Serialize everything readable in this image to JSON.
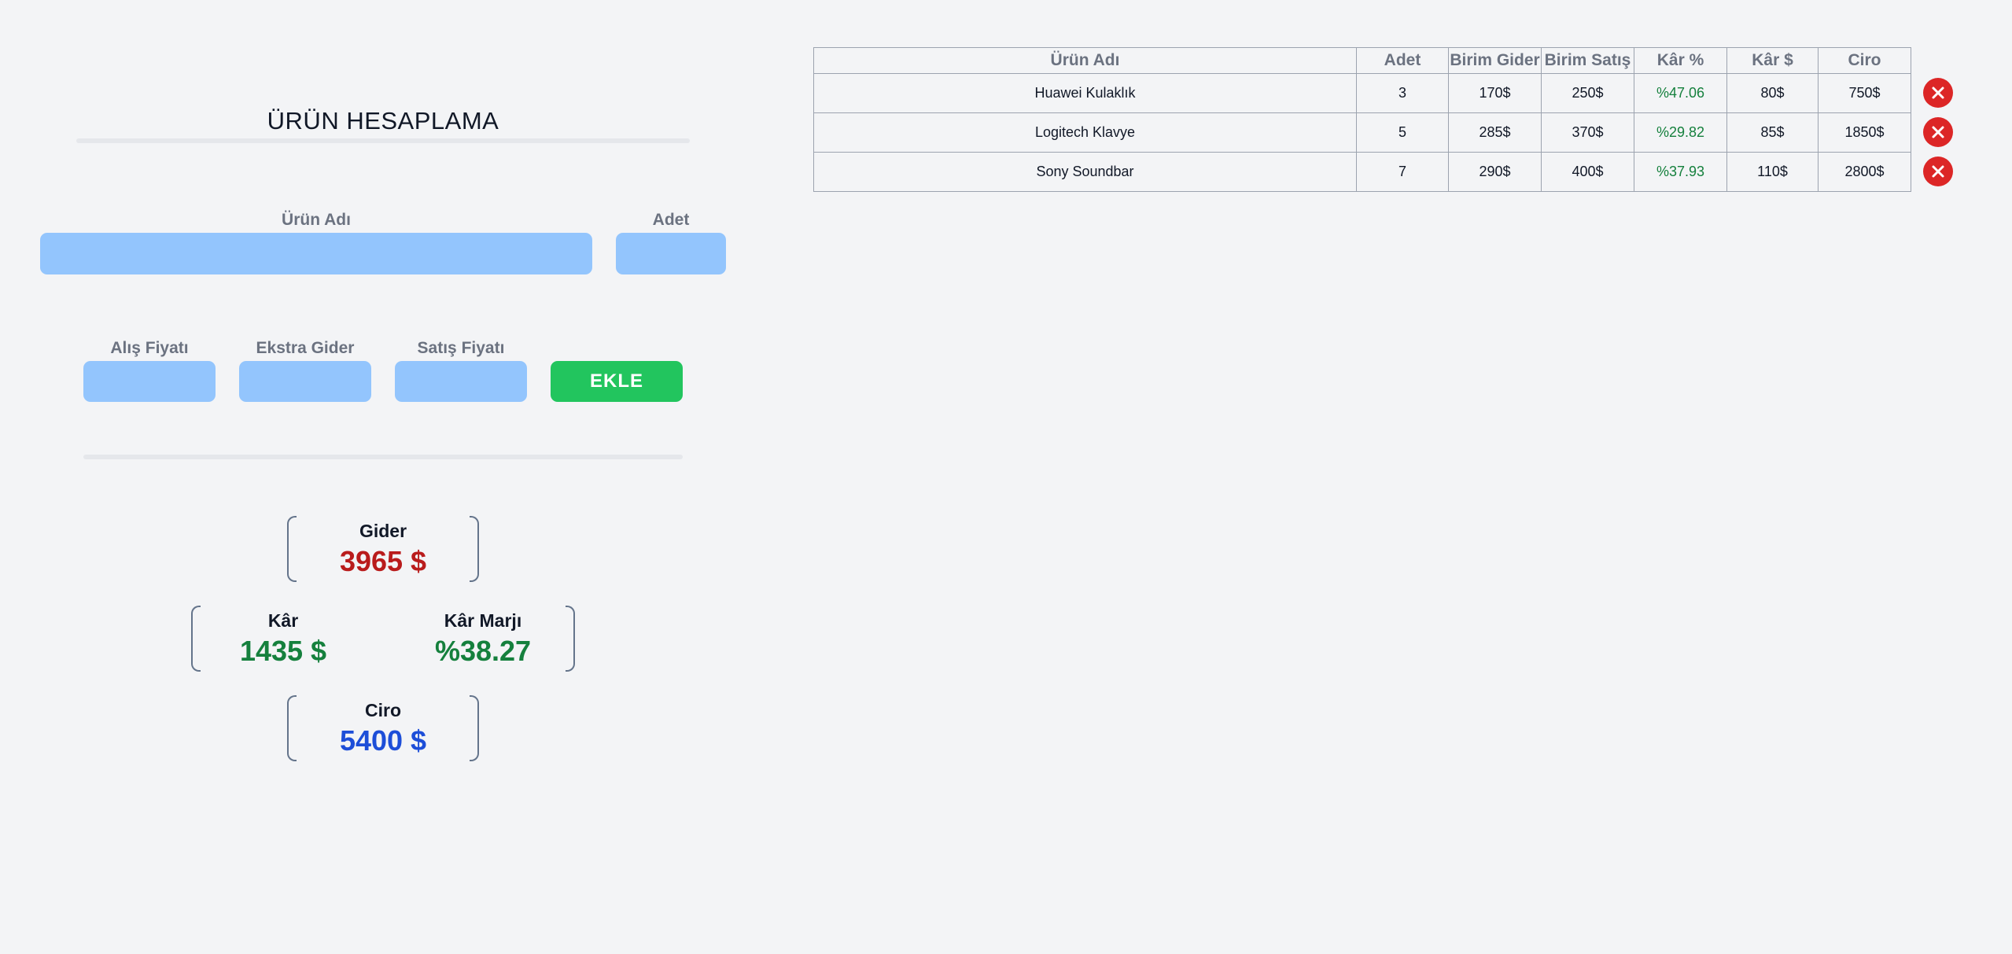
{
  "form": {
    "title": "ÜRÜN HESAPLAMA",
    "product_name_label": "Ürün Adı",
    "product_name_value": "",
    "quantity_label": "Adet",
    "quantity_value": "",
    "purchase_price_label": "Alış Fiyatı",
    "purchase_price_value": "",
    "extra_cost_label": "Ekstra Gider",
    "extra_cost_value": "",
    "sale_price_label": "Satış Fiyatı",
    "sale_price_value": "",
    "add_button_label": "EKLE"
  },
  "summary": {
    "expense_label": "Gider",
    "expense_value": "3965 $",
    "profit_label": "Kâr",
    "profit_value": "1435 $",
    "margin_label": "Kâr Marjı",
    "margin_value": "%38.27",
    "revenue_label": "Ciro",
    "revenue_value": "5400 $"
  },
  "table": {
    "headers": [
      "Ürün Adı",
      "Adet",
      "Birim Gider",
      "Birim Satış",
      "Kâr %",
      "Kâr $",
      "Ciro"
    ],
    "rows": [
      [
        "Huawei Kulaklık",
        "3",
        "170$",
        "250$",
        "%47.06",
        "80$",
        "750$"
      ],
      [
        "Logitech Klavye",
        "5",
        "285$",
        "370$",
        "%29.82",
        "85$",
        "1850$"
      ],
      [
        "Sony Soundbar",
        "7",
        "290$",
        "400$",
        "%37.93",
        "110$",
        "2800$"
      ]
    ]
  },
  "colors": {
    "input_bg": "#93c5fd",
    "add_button": "#22c55e",
    "delete_button": "#dc2626",
    "expense": "#b91c1c",
    "profit": "#15803d",
    "revenue": "#1d4ed8"
  },
  "icons": {
    "delete": "close-icon"
  }
}
